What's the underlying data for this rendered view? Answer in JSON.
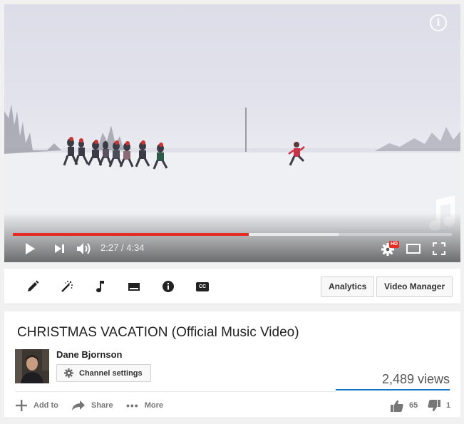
{
  "player": {
    "current_time": "2:27",
    "duration": "4:34",
    "time_separator": "/",
    "played_fraction": 0.537,
    "buffered_fraction": 0.742,
    "hd_badge": "HD",
    "info_glyph": "i",
    "accent_color": "#e52d27",
    "icons": [
      "play-icon",
      "next-icon",
      "volume-icon",
      "settings-gear-icon",
      "theater-mode-icon",
      "fullscreen-icon",
      "music-note-icon",
      "info-icon"
    ]
  },
  "toolbar": {
    "tools": [
      "edit-icon",
      "enhancements-icon",
      "audio-icon",
      "end-screen-icon",
      "cards-icon",
      "subtitles-icon"
    ],
    "cc_label": "CC",
    "analytics_label": "Analytics",
    "video_manager_label": "Video Manager"
  },
  "video": {
    "title": "CHRISTMAS VACATION (Official Music Video)",
    "owner": "Dane Bjornson",
    "channel_settings_label": "Channel settings",
    "views": "2,489 views",
    "add_to_label": "Add to",
    "share_label": "Share",
    "more_label": "More",
    "likes": "65",
    "dislikes": "1",
    "views_bar_color": "#167ac6"
  }
}
